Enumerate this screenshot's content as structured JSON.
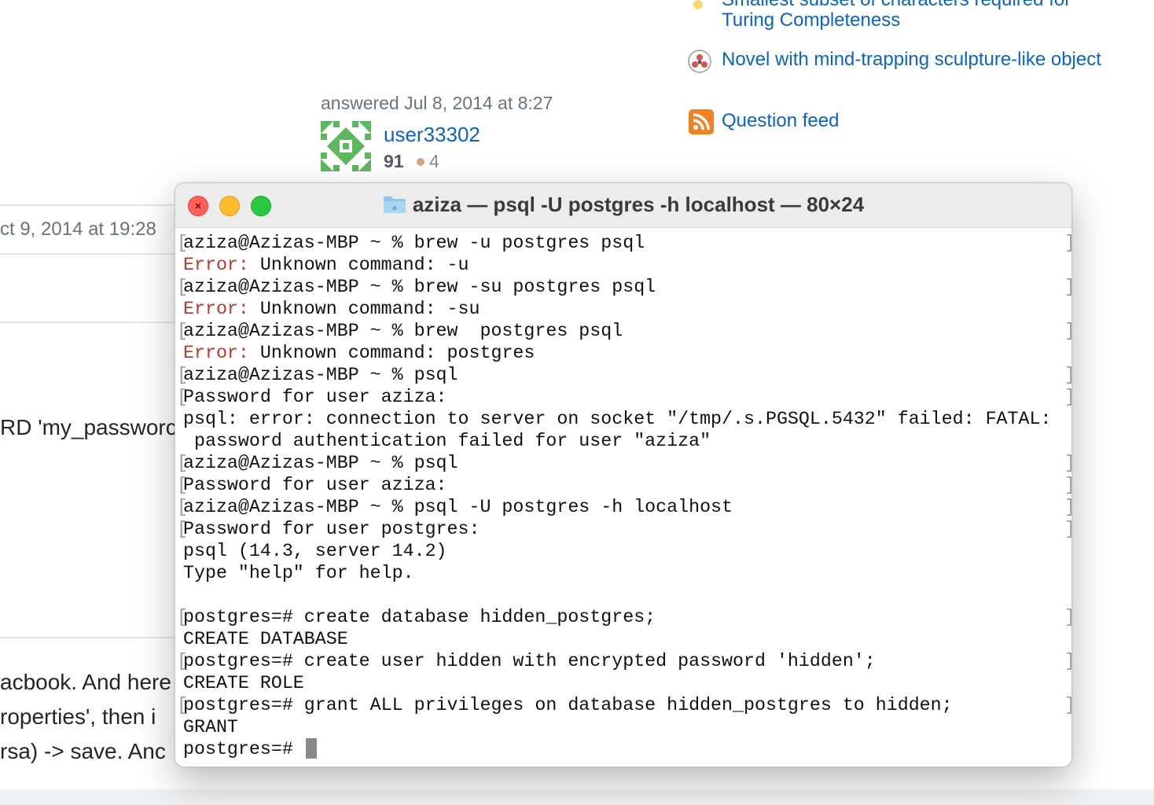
{
  "sidebar": {
    "related_partial": "Smallest subset of characters required for",
    "related_1": "Turing Completeness",
    "related_2": "Novel with mind-trapping sculpture-like object",
    "question_feed": "Question feed"
  },
  "answer": {
    "answered": "answered Jul 8, 2014 at 8:27",
    "user_name": "user33302",
    "reputation": "91",
    "bronze_badges": "4",
    "comment_date_fragment": "ct 9, 2014 at 19:28",
    "text_fragment_1": "RD 'my_passworc",
    "text_fragment_2": "acbook. And here",
    "text_fragment_3": "roperties', then i",
    "text_fragment_4": "rsa) -> save. Anc"
  },
  "terminal": {
    "title": "aziza — psql -U postgres -h localhost — 80×24",
    "lines": [
      {
        "text": "aziza@Azizas-MBP ~ % brew -u postgres psql",
        "bracket": true
      },
      {
        "error_label": "Error:",
        "text": " Unknown command: -u",
        "bracket": false
      },
      {
        "text": "aziza@Azizas-MBP ~ % brew -su postgres psql",
        "bracket": true
      },
      {
        "error_label": "Error:",
        "text": " Unknown command: -su",
        "bracket": false
      },
      {
        "text": "aziza@Azizas-MBP ~ % brew  postgres psql",
        "bracket": true
      },
      {
        "error_label": "Error:",
        "text": " Unknown command: postgres",
        "bracket": false
      },
      {
        "text": "aziza@Azizas-MBP ~ % psql",
        "bracket": true
      },
      {
        "text": "Password for user aziza:",
        "bracket": true
      },
      {
        "text": "psql: error: connection to server on socket \"/tmp/.s.PGSQL.5432\" failed: FATAL:",
        "bracket": false
      },
      {
        "text": " password authentication failed for user \"aziza\"",
        "bracket": false
      },
      {
        "text": "aziza@Azizas-MBP ~ % psql",
        "bracket": true
      },
      {
        "text": "Password for user aziza:",
        "bracket": true
      },
      {
        "text": "aziza@Azizas-MBP ~ % psql -U postgres -h localhost",
        "bracket": true
      },
      {
        "text": "Password for user postgres:",
        "bracket": true
      },
      {
        "text": "psql (14.3, server 14.2)",
        "bracket": false
      },
      {
        "text": "Type \"help\" for help.",
        "bracket": false
      },
      {
        "text": "",
        "bracket": false
      },
      {
        "text": "postgres=# create database hidden_postgres;",
        "bracket": true
      },
      {
        "text": "CREATE DATABASE",
        "bracket": false
      },
      {
        "text": "postgres=# create user hidden with encrypted password 'hidden';",
        "bracket": true
      },
      {
        "text": "CREATE ROLE",
        "bracket": false
      },
      {
        "text": "postgres=# grant ALL privileges on database hidden_postgres to hidden;",
        "bracket": true
      },
      {
        "text": "GRANT",
        "bracket": false
      },
      {
        "text": "postgres=# ",
        "bracket": false,
        "cursor": true
      }
    ]
  },
  "icons": {
    "feed": "rss-icon",
    "folder": "folder-icon",
    "avatar": "identicon-avatar"
  },
  "colors": {
    "link": "#0a64c8",
    "error": "#c0392b",
    "close": "#ff5f57",
    "minimize": "#febc2e",
    "maximize": "#28c840"
  }
}
